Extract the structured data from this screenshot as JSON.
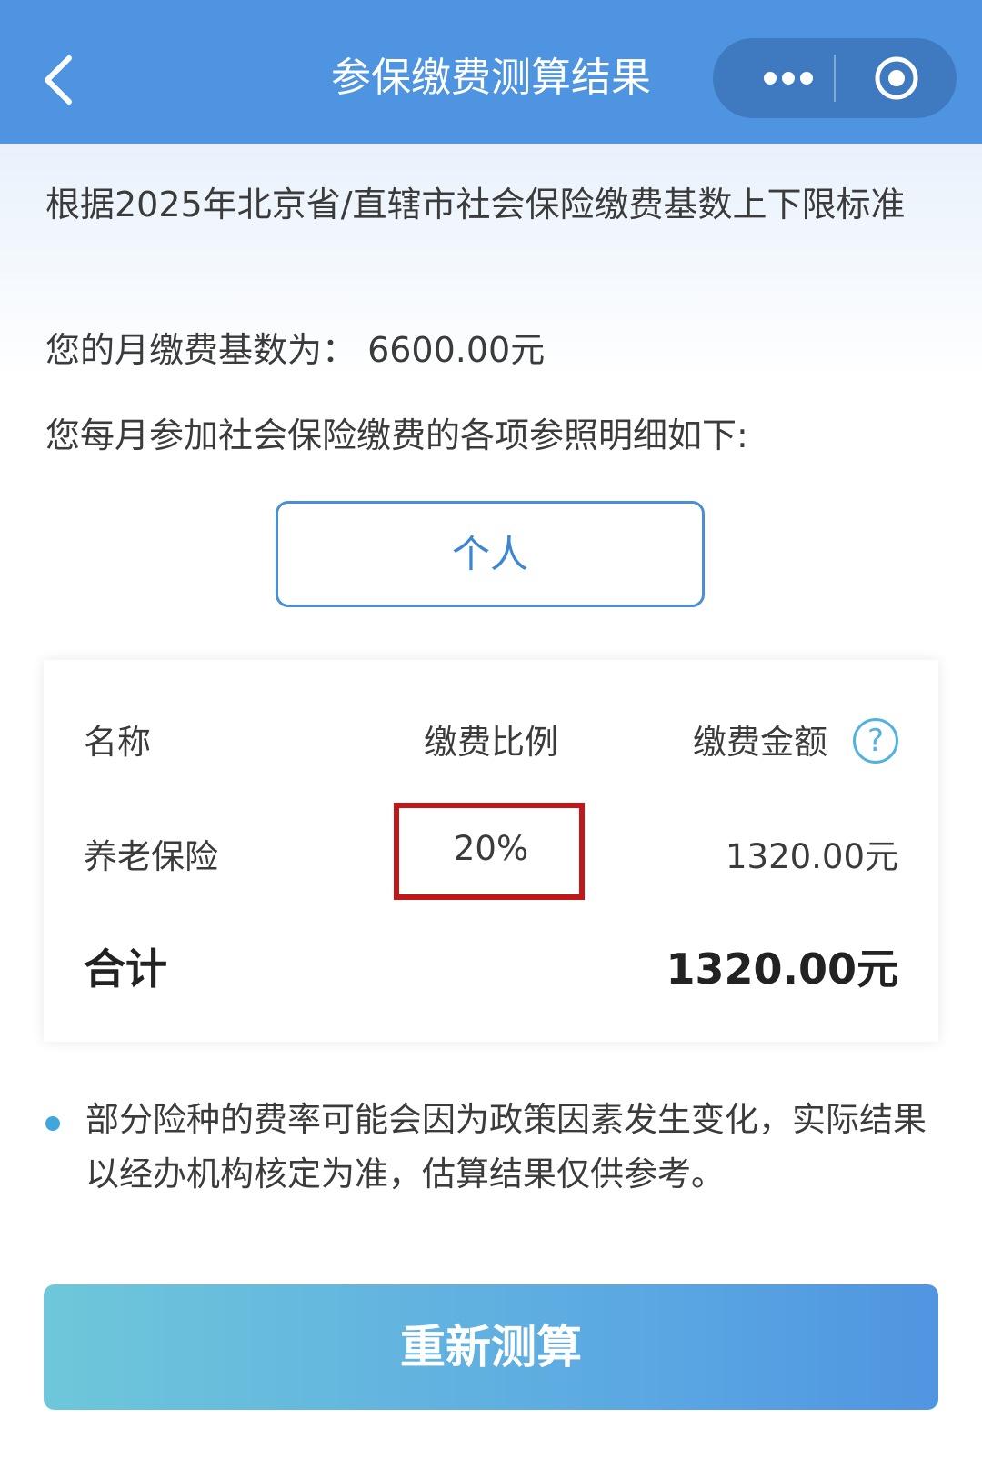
{
  "header": {
    "title": "参保缴费测算结果"
  },
  "info": {
    "intro": "根据2025年北京省/直辖市社会保险缴费基数上下限标准",
    "base": "您的月缴费基数为：  6600.00元",
    "detail_intro": "您每月参加社会保险缴费的各项参照明细如下:"
  },
  "tabs": [
    {
      "label": "个人",
      "selected": true
    }
  ],
  "table": {
    "headers": [
      "名称",
      "缴费比例",
      "缴费金额"
    ],
    "help_symbol": "?",
    "rows": [
      {
        "name": "养老保险",
        "rate": "20%",
        "amount": "1320.00元"
      }
    ],
    "total": {
      "label": "合计",
      "amount": "1320.00元"
    }
  },
  "note": "部分险种的费率可能会因为政策因素发生变化，实际结果以经办机构核定为准，估算结果仅供参考。",
  "recalc_label": "重新测算",
  "colors": {
    "header": "#4f94e0",
    "accent": "#4a8fd6",
    "highlight": "#c0181a"
  }
}
